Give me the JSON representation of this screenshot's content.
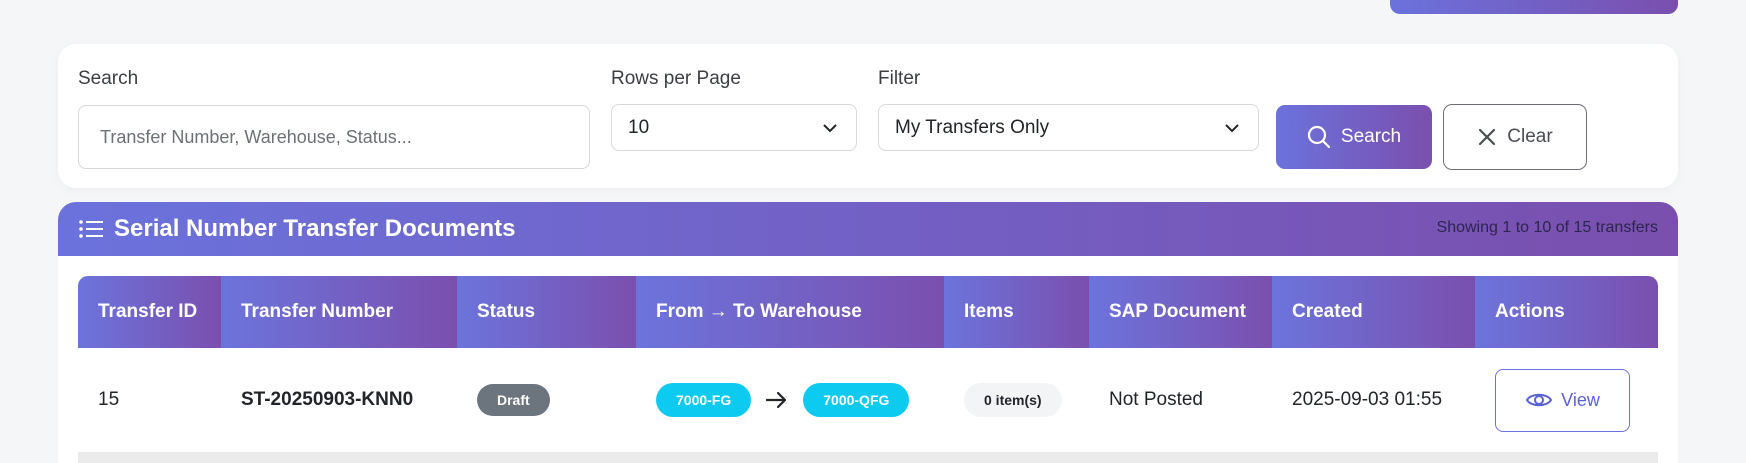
{
  "filters": {
    "search_label": "Search",
    "search_placeholder": "Transfer Number, Warehouse, Status...",
    "rows_label": "Rows per Page",
    "rows_value": "10",
    "filter_label": "Filter",
    "filter_value": "My Transfers Only",
    "search_button": "Search",
    "clear_button": "Clear"
  },
  "table_card": {
    "title": "Serial Number Transfer Documents",
    "showing": "Showing 1 to 10 of 15 transfers",
    "columns": [
      "Transfer ID",
      "Transfer Number",
      "Status",
      "From → To Warehouse",
      "Items",
      "SAP Document",
      "Created",
      "Actions"
    ],
    "rows": [
      {
        "id": "15",
        "number": "ST-20250903-KNN0",
        "status": "Draft",
        "from_wh": "7000-FG",
        "to_wh": "7000-QFG",
        "items": "0 item(s)",
        "sap": "Not Posted",
        "created": "2025-09-03 01:55",
        "action": "View"
      }
    ]
  },
  "colors": {
    "accent_start": "#6b72dc",
    "accent_end": "#7a4fae",
    "draft_badge": "#6c757d",
    "warehouse_badge": "#0dcaf0"
  }
}
